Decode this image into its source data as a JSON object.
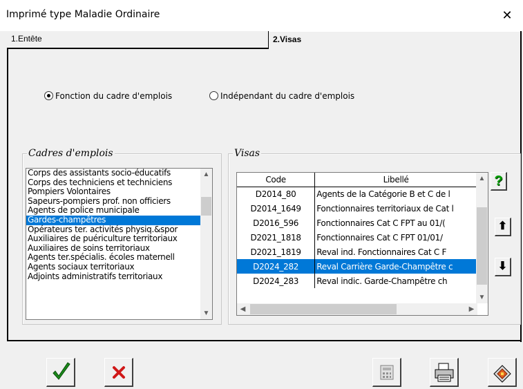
{
  "window": {
    "title": "Imprimé type Maladie Ordinaire",
    "close_glyph": "✕"
  },
  "tabs": [
    {
      "label": "1.Entête",
      "active": false
    },
    {
      "label": "2.Visas",
      "active": true
    }
  ],
  "radios": {
    "option1": {
      "label": "Fonction du cadre d'emplois",
      "checked": true
    },
    "option2": {
      "label": "Indépendant du cadre d'emplois",
      "checked": false
    }
  },
  "cadres": {
    "title": "Cadres d'emplois",
    "items": [
      "Corps des assistants socio-éducatifs",
      "Corps des techniciens et techniciens",
      "Pompiers Volontaires",
      "Sapeurs-pompiers prof. non officiers",
      "Agents de police municipale",
      "Gardes-champêtres",
      "Opérateurs ter. activités physiq.&spor",
      "Auxiliaires de puériculture territoriaux",
      "Auxiliaires de soins territoriaux",
      "Agents ter.spécialis. écoles maternell",
      "Agents sociaux territoriaux",
      "Adjoints administratifs territoriaux"
    ],
    "selected_index": 5
  },
  "visas": {
    "title": "Visas",
    "columns": [
      "Code",
      "Libellé"
    ],
    "rows": [
      [
        "D2014_80",
        "Agents de la Catégorie B et C de l"
      ],
      [
        "D2014_1649",
        "Fonctionnaires territoriaux de Cat l"
      ],
      [
        "D2016_596",
        "Fonctionnaires Cat C FPT au 01/("
      ],
      [
        "D2021_1818",
        "Fonctionnaires Cat C FPT 01/01/"
      ],
      [
        "D2021_1819",
        "Reval ind. Fonctionnaires Cat C F"
      ],
      [
        "D2024_282",
        "Reval Carrière Garde-Champêtre c"
      ],
      [
        "D2024_283",
        "Reval indic. Garde-Champêtre ch"
      ]
    ],
    "selected_index": 5
  },
  "side_buttons": {
    "help": "?",
    "up": "⬆",
    "down": "⬇"
  },
  "colors": {
    "selection": "#0078d7",
    "help_green": "#00a000"
  }
}
